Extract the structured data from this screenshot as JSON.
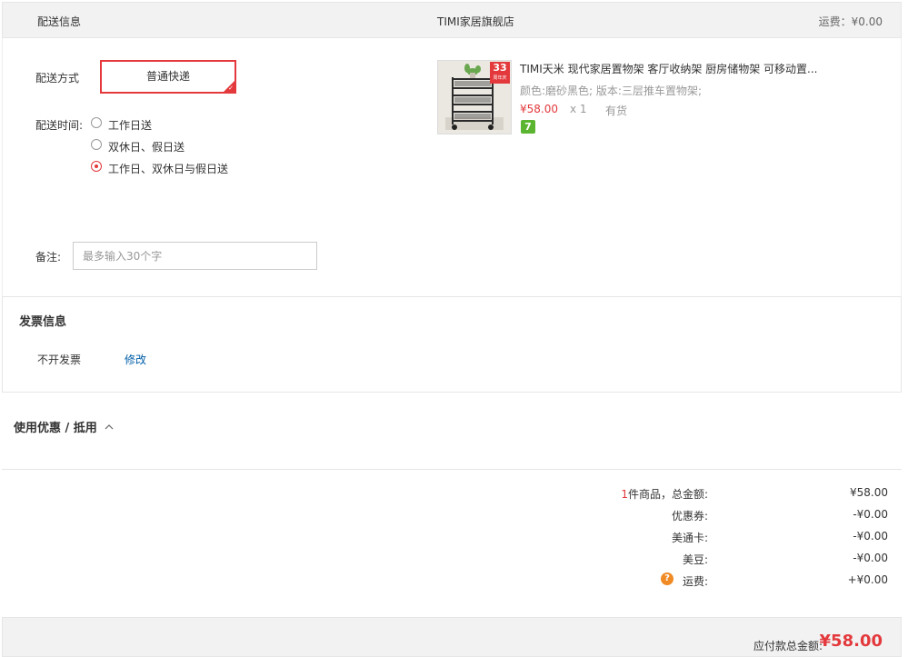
{
  "header": {
    "section_title": "配送信息",
    "shop_name": "TIMI家居旗舰店",
    "shipping_fee": "运费：¥0.00"
  },
  "delivery": {
    "method_label": "配送方式",
    "method_selected": "普通快递",
    "time_label": "配送时间:",
    "options": [
      {
        "label": "工作日送",
        "selected": false
      },
      {
        "label": "双休日、假日送",
        "selected": false
      },
      {
        "label": "工作日、双休日与假日送",
        "selected": true
      }
    ],
    "note_label": "备注:",
    "note_value": "",
    "note_placeholder": "最多输入30个字"
  },
  "product": {
    "badge_number": "33",
    "badge_sub": "周年庆",
    "title": "TIMI天米 现代家居置物架 客厅收纳架 厨房储物架 可移动置...",
    "attrs": "颜色:磨砂黑色; 版本:三层推车置物架;",
    "price": "¥58.00",
    "quantity": "x 1",
    "stock": "有货",
    "seven_badge": "7"
  },
  "invoice": {
    "title": "发票信息",
    "value": "不开发票",
    "edit_link": "修改"
  },
  "discount": {
    "title": "使用优惠 / 抵用",
    "chevron": "chevron-up-icon"
  },
  "summary": {
    "count": "1",
    "items": [
      {
        "label_suffix": "件商品，总金额:",
        "value": "¥58.00"
      },
      {
        "label": "优惠券:",
        "value": "-¥0.00"
      },
      {
        "label": "美通卡:",
        "value": "-¥0.00"
      },
      {
        "label": "美豆:",
        "value": "-¥0.00"
      },
      {
        "label": "运费:",
        "value": "+¥0.00",
        "icon": "question-icon"
      }
    ]
  },
  "footer": {
    "total_label": "应付款总金额:",
    "total_value": "¥58.00"
  },
  "colors": {
    "accent": "#e4393c",
    "link": "#005ea7",
    "help_icon": "#f08a24",
    "seven_badge": "#5cb531"
  }
}
